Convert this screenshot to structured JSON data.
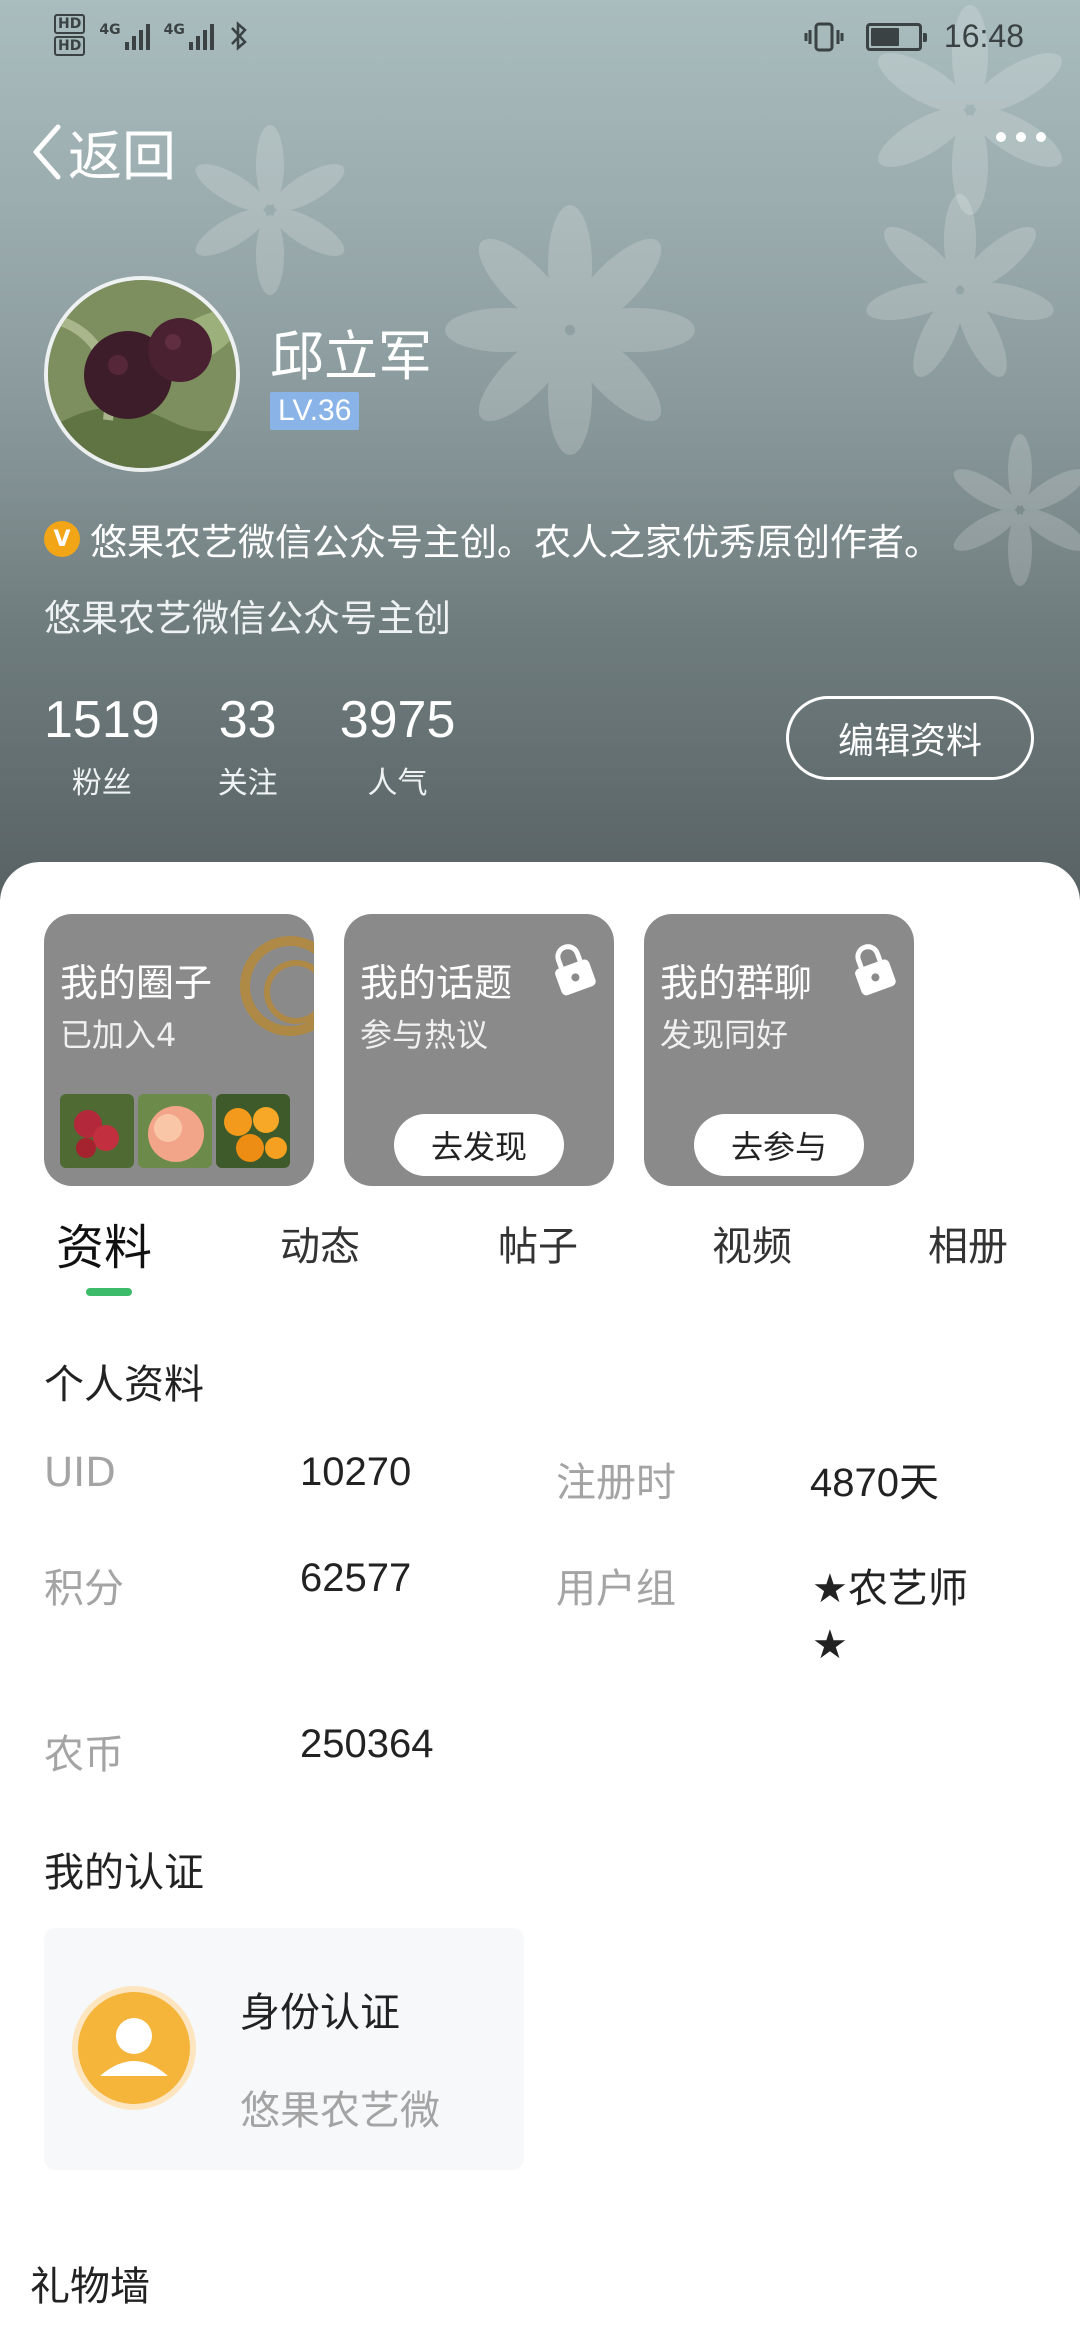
{
  "status_bar": {
    "time": "16:48",
    "hd1": "HD",
    "hd2": "HD",
    "net1": "4G",
    "net2": "4G"
  },
  "nav": {
    "back_label": "返回"
  },
  "profile": {
    "name": "邱立军",
    "level": "LV.36",
    "verify_text": "悠果农艺微信公众号主创。农人之家优秀原创作者。",
    "verify_icon_letter": "V",
    "signature": "悠果农艺微信公众号主创",
    "stats": [
      {
        "value": "1519",
        "label": "粉丝"
      },
      {
        "value": "33",
        "label": "关注"
      },
      {
        "value": "3975",
        "label": "人气"
      }
    ],
    "edit_button": "编辑资料"
  },
  "cards": {
    "circle": {
      "title": "我的圈子",
      "sub": "已加入4"
    },
    "topic": {
      "title": "我的话题",
      "sub": "参与热议",
      "button": "去发现"
    },
    "group": {
      "title": "我的群聊",
      "sub": "发现同好",
      "button": "去参与"
    }
  },
  "tabs": [
    "资料",
    "动态",
    "帖子",
    "视频",
    "相册"
  ],
  "personal_info": {
    "title": "个人资料",
    "uid_label": "UID",
    "uid_value": "10270",
    "reg_label": "注册时",
    "reg_value": "4870天",
    "points_label": "积分",
    "points_value": "62577",
    "group_label": "用户组",
    "group_value_line1": "★农艺师",
    "group_value_line2": "★",
    "coins_label": "农币",
    "coins_value": "250364"
  },
  "certification": {
    "title": "我的认证",
    "card_title": "身份认证",
    "card_sub": "悠果农艺微"
  },
  "gift_wall": {
    "title": "礼物墙"
  },
  "colors": {
    "accent_green": "#3cbb6a",
    "level_badge": "#8ab4e8",
    "verify_orange": "#f2a516",
    "card_gray": "#8a8a8a",
    "label_gray": "#a4a4a4"
  },
  "icons": [
    "back-chevron-icon",
    "more-icon",
    "verified-icon",
    "lock-icon",
    "user-icon",
    "bluetooth-icon",
    "vibrate-icon",
    "battery-icon",
    "signal-icon"
  ]
}
